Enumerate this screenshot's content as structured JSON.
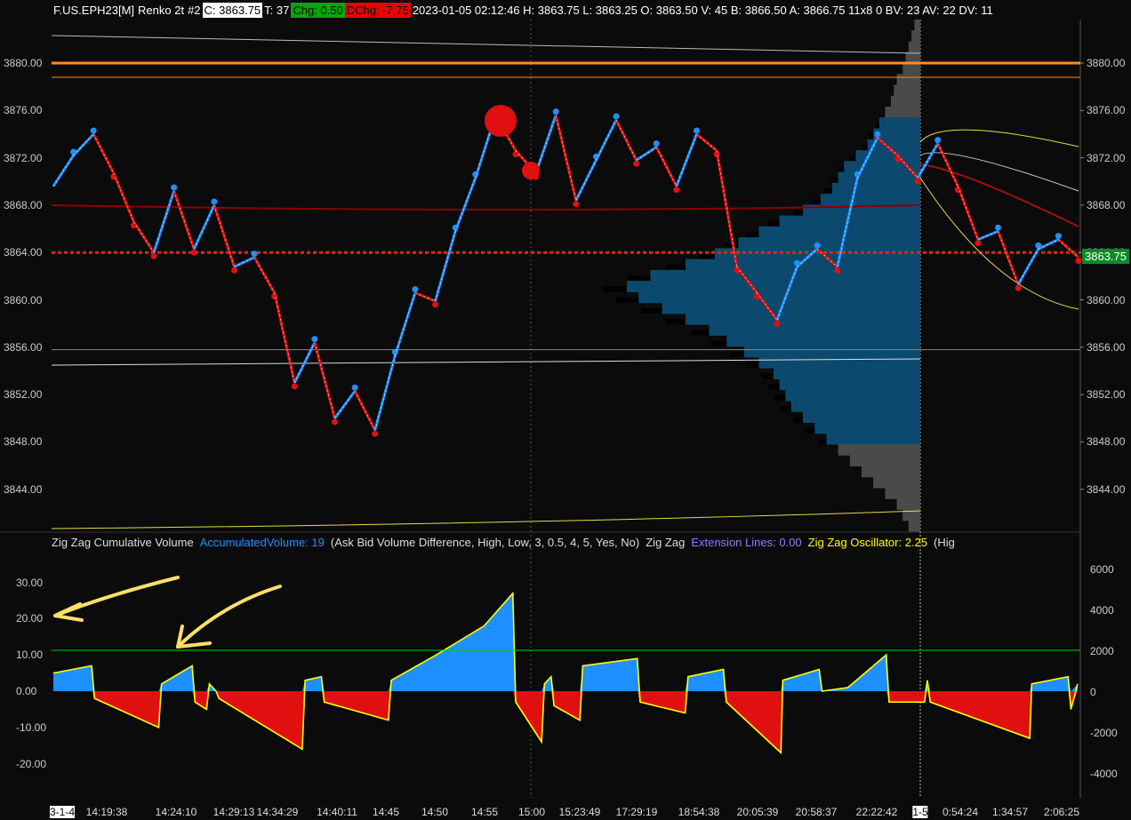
{
  "header": {
    "symbol": "F.US.EPH23[M]",
    "bar_type": "Renko 2t",
    "chart_num": "#2",
    "close": "C: 3863.75",
    "ticks": "T: 37",
    "chg": "Chg: 0.50",
    "dchg": "DChg: -7.75",
    "info": "2023-01-05 02:12:46 H: 3863.75 L: 3863.25 O: 3863.50 V: 45 B: 3866.50 A: 3866.75 11x8 0 BV: 23 AV: 22 DV: 11"
  },
  "study_line": {
    "name": "Zig Zag Cumulative Volume",
    "accumulated": "AccumulatedVolume: 19",
    "params": "(Ask Bid Volume Difference, High, Low, 3, 0.5, 4, 5, Yes, No)",
    "zigzag": "Zig Zag",
    "extension": "Extension Lines: 0.00",
    "oscillator": "Zig Zag Oscillator: 2.25",
    "more": "(Hig"
  },
  "price_axis": {
    "labels": [
      "3880.00",
      "3876.00",
      "3872.00",
      "3868.00",
      "3864.00",
      "3860.00",
      "3856.00",
      "3852.00",
      "3848.00",
      "3844.00"
    ],
    "last_price": "3863.75"
  },
  "lower_axis_left": [
    "30.00",
    "20.00",
    "10.00",
    "0.00",
    "-10.00",
    "-20.00"
  ],
  "lower_axis_right": [
    "6000",
    "4000",
    "2000",
    "0",
    "-2000",
    "-4000"
  ],
  "time_axis": [
    "3-1-4",
    "14:19:38",
    "14:24:10",
    "14:29:13",
    "14:34:29",
    "14:40:11",
    "14:45",
    "14:50",
    "14:55",
    "15:00",
    "15:23:49",
    "17:29:19",
    "18:54:38",
    "20:05:39",
    "20:58:37",
    "22:22:42",
    "1-5",
    "0:54:24",
    "1:34:57",
    "2:06:25"
  ],
  "colors": {
    "up": "#1e90ff",
    "down": "#e01010",
    "orange": "#ff8c1a",
    "profile_grey": "#4a4a4a",
    "profile_blue": "#0b4a6e",
    "osc_line": "#ffff00"
  },
  "chart_data": {
    "type": "line",
    "title": "F.US.EPH23[M] Renko 2t",
    "price_path": [
      3869.6,
      3872.2,
      3874,
      3870.7,
      3866.6,
      3864,
      3869.2,
      3864.3,
      3868,
      3862.8,
      3863.6,
      3860.6,
      3853,
      3856.4,
      3850,
      3852.3,
      3849,
      3855.3,
      3860.6,
      3859.9,
      3865.8,
      3870.3,
      3875.6,
      3872.6,
      3870.7,
      3875.6,
      3868.4,
      3871.8,
      3875.2,
      3871.8,
      3872.9,
      3869.6,
      3874,
      3872.6,
      3862.8,
      3860.6,
      3858.3,
      3862.8,
      3864.3,
      3862.8,
      3870.3,
      3873.7,
      3872.2,
      3870.3,
      3873.2,
      3869.6,
      3865.1,
      3865.8,
      3861.3,
      3864.3,
      3865.1,
      3863.6
    ],
    "ylim": [
      3841,
      3884
    ],
    "levels": {
      "orange_high": 3880,
      "orange_low": 3878.8,
      "vwap": 3868,
      "poc": 3864,
      "grey_line": 3855.8
    },
    "oscillator": {
      "ylim": [
        -30,
        34
      ],
      "points": [
        [
          0,
          5
        ],
        [
          4,
          7
        ],
        [
          4.3,
          -2
        ],
        [
          11,
          -10
        ],
        [
          11.3,
          2
        ],
        [
          14.5,
          7
        ],
        [
          14.8,
          -3
        ],
        [
          16,
          -5
        ],
        [
          16.3,
          2
        ],
        [
          17,
          0
        ],
        [
          17.3,
          -2
        ],
        [
          26,
          -16
        ],
        [
          26.3,
          3
        ],
        [
          28,
          4
        ],
        [
          28.3,
          -3
        ],
        [
          35,
          -8
        ],
        [
          35.3,
          3
        ],
        [
          40,
          10
        ],
        [
          45,
          18
        ],
        [
          48,
          27
        ],
        [
          48.3,
          -3
        ],
        [
          51,
          -14
        ],
        [
          51.3,
          2
        ],
        [
          52,
          4
        ],
        [
          52.3,
          -4
        ],
        [
          55,
          -8
        ],
        [
          55.3,
          7
        ],
        [
          61,
          9
        ],
        [
          61.3,
          -3
        ],
        [
          66,
          -6
        ],
        [
          66.3,
          4
        ],
        [
          70,
          6
        ],
        [
          70.3,
          -3
        ],
        [
          76,
          -17
        ],
        [
          76.2,
          3
        ],
        [
          80,
          6
        ],
        [
          80.3,
          0
        ],
        [
          83,
          1
        ],
        [
          87,
          10
        ],
        [
          87.3,
          -3
        ],
        [
          91,
          -3
        ],
        [
          91.3,
          3
        ],
        [
          91.6,
          -3
        ],
        [
          102,
          -13
        ],
        [
          102.2,
          2
        ],
        [
          106,
          4
        ],
        [
          106.3,
          -5
        ],
        [
          107,
          2
        ]
      ]
    },
    "volume_profile": [
      2,
      3,
      4,
      5,
      6,
      8,
      9,
      10,
      12,
      14,
      16,
      18,
      22,
      26,
      28,
      30,
      34,
      40,
      48,
      55,
      62,
      70,
      80,
      92,
      100,
      96,
      88,
      80,
      72,
      66,
      60,
      55,
      50,
      48,
      46,
      44,
      40,
      36,
      32,
      28,
      24,
      20,
      16,
      12,
      8,
      6,
      4
    ]
  }
}
